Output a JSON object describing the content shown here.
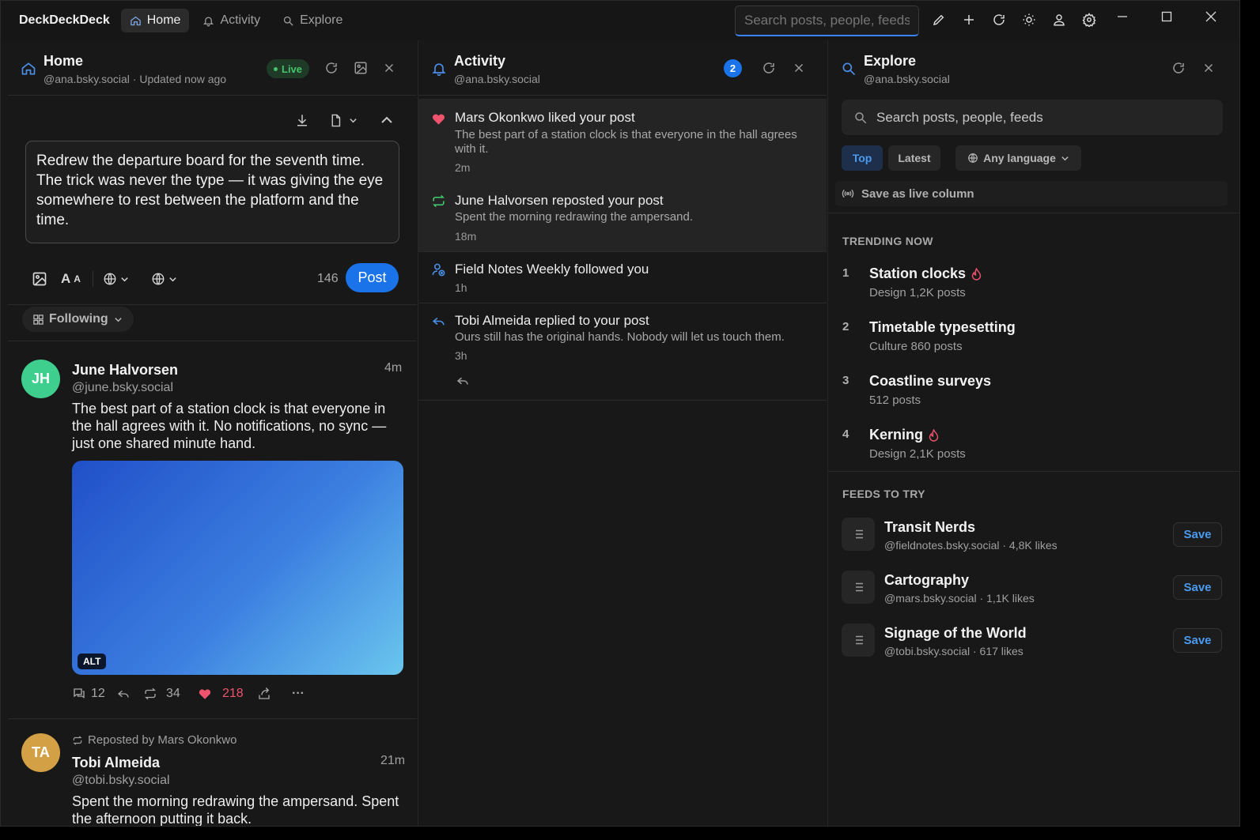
{
  "app": {
    "name": "DeckDeckDeck"
  },
  "nav": {
    "tabs": [
      {
        "label": "Home",
        "icon": "home-icon",
        "active": true
      },
      {
        "label": "Activity",
        "icon": "bell-icon",
        "active": false
      },
      {
        "label": "Explore",
        "icon": "search-icon",
        "active": false
      }
    ],
    "search_placeholder": "Search posts, people, feeds",
    "accent_color": "#3b82f6"
  },
  "home": {
    "title": "Home",
    "subtitle": "@ana.bsky.social · Updated now ago",
    "live_label": "Live",
    "composer": {
      "text": "Redrew the departure board for the seventh time. The trick was never the type — it was giving the eye somewhere to rest between the platform and the time.",
      "char_count": "146",
      "post_label": "Post"
    },
    "filter_label": "Following",
    "posts": [
      {
        "initials": "JH",
        "avatar_color": "#3ecf8e",
        "name": "June Halvorsen",
        "handle": "@june.bsky.social",
        "time": "4m",
        "text": "The best part of a station clock is that everyone in the hall agrees with it. No notifications, no sync — just one shared minute hand.",
        "alt_label": "ALT",
        "replies": "12",
        "reposts": "34",
        "likes": "218"
      },
      {
        "repost_label": "Reposted by Mars Okonkwo",
        "initials": "TA",
        "avatar_color": "#d4a046",
        "name": "Tobi Almeida",
        "handle": "@tobi.bsky.social",
        "time": "21m",
        "text": "Spent the morning redrawing the ampersand. Spent the afternoon putting it back."
      }
    ]
  },
  "activity": {
    "title": "Activity",
    "subtitle": "@ana.bsky.social",
    "badge_count": "2",
    "notifications": [
      {
        "type": "like",
        "title": "Mars Okonkwo liked your post",
        "body": "The best part of a station clock is that everyone in the hall agrees with it.",
        "time": "2m"
      },
      {
        "type": "repost",
        "title": "June Halvorsen reposted your post",
        "body": "Spent the morning redrawing the ampersand.",
        "time": "18m"
      },
      {
        "type": "follow",
        "title": "Field Notes Weekly followed you",
        "body": "",
        "time": "1h"
      },
      {
        "type": "reply",
        "title": "Tobi Almeida replied to your post",
        "body": "Ours still has the original hands. Nobody will let us touch them.",
        "time": "3h"
      }
    ]
  },
  "explore": {
    "title": "Explore",
    "subtitle": "@ana.bsky.social",
    "search_placeholder": "Search posts, people, feeds",
    "filters": {
      "top": "Top",
      "latest": "Latest",
      "language": "Any language"
    },
    "save_live_label": "Save as live column",
    "trending_heading": "TRENDING NOW",
    "trending": [
      {
        "rank": "1",
        "title": "Station clocks",
        "meta": "Design 1,2K posts",
        "hot": true
      },
      {
        "rank": "2",
        "title": "Timetable typesetting",
        "meta": "Culture 860 posts",
        "hot": false
      },
      {
        "rank": "3",
        "title": "Coastline surveys",
        "meta": "512 posts",
        "hot": false
      },
      {
        "rank": "4",
        "title": "Kerning",
        "meta": "Design 2,1K posts",
        "hot": true
      }
    ],
    "feeds_heading": "FEEDS TO TRY",
    "feeds": [
      {
        "title": "Transit Nerds",
        "meta": "@fieldnotes.bsky.social · 4,8K likes",
        "save_label": "Save"
      },
      {
        "title": "Cartography",
        "meta": "@mars.bsky.social · 1,1K likes",
        "save_label": "Save"
      },
      {
        "title": "Signage of the World",
        "meta": "@tobi.bsky.social · 617 likes",
        "save_label": "Save"
      }
    ]
  }
}
